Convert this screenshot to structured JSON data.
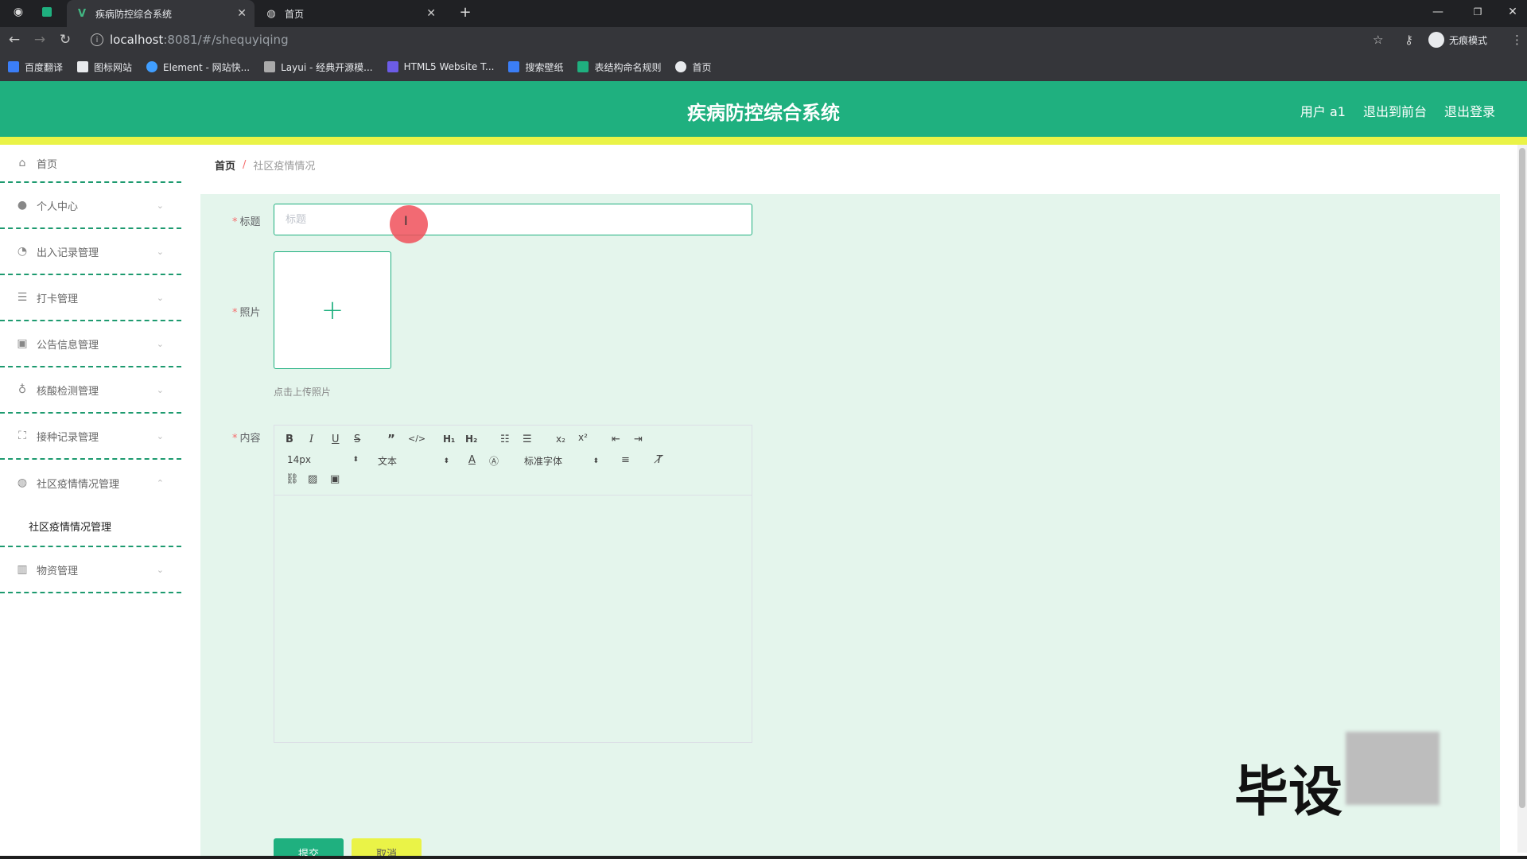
{
  "browser": {
    "tabs": [
      {
        "title": "疾病防控综合系统",
        "active": true,
        "icon": "vue-icon"
      },
      {
        "title": "首页",
        "active": false,
        "icon": "globe-icon"
      }
    ],
    "url_host": "localhost",
    "url_path": ":8081/#/shequyiqing",
    "incognito_label": "无痕模式",
    "bookmarks": [
      {
        "label": "百度翻译",
        "icon": "translate-icon",
        "color": "#3b7ef6"
      },
      {
        "label": "图标网站",
        "icon": "flag-icon",
        "color": "#e8eaed"
      },
      {
        "label": "Element - 网站快...",
        "icon": "element-icon",
        "color": "#409eff"
      },
      {
        "label": "Layui - 经典开源模...",
        "icon": "layui-icon",
        "color": "#aaaaaa"
      },
      {
        "label": "HTML5 Website T...",
        "icon": "html5-icon",
        "color": "#6c5ce7"
      },
      {
        "label": "搜索壁纸",
        "icon": "wallpaper-icon",
        "color": "#3b7ef6"
      },
      {
        "label": "表结构命名规则",
        "icon": "table-icon",
        "color": "#1fb07f"
      },
      {
        "label": "首页",
        "icon": "globe-icon",
        "color": "#e8eaed"
      }
    ]
  },
  "header": {
    "title": "疾病防控综合系统",
    "user": "用户 a1",
    "frontend_link": "退出到前台",
    "logout": "退出登录",
    "brand_color": "#1fb07f",
    "accent_color": "#eaf347"
  },
  "sidebar": {
    "items": [
      {
        "label": "首页",
        "icon": "home-icon"
      },
      {
        "label": "个人中心",
        "icon": "user-icon"
      },
      {
        "label": "出入记录管理",
        "icon": "compass-icon"
      },
      {
        "label": "打卡管理",
        "icon": "list-icon"
      },
      {
        "label": "公告信息管理",
        "icon": "clipboard-icon"
      },
      {
        "label": "核酸检测管理",
        "icon": "microphone-icon"
      },
      {
        "label": "接种记录管理",
        "icon": "fullscreen-icon"
      },
      {
        "label": "社区疫情情况管理",
        "icon": "globe-icon"
      },
      {
        "label": "物资管理",
        "icon": "chart-icon"
      }
    ],
    "submenu_label": "社区疫情情况管理"
  },
  "breadcrumb": {
    "home": "首页",
    "separator": "/",
    "current": "社区疫情情况"
  },
  "form": {
    "title_label": "标题",
    "title_placeholder": "标题",
    "title_value": "",
    "photo_label": "照片",
    "photo_hint": "点击上传照片",
    "content_label": "内容",
    "required_mark": "*",
    "submit_label": "提交",
    "cancel_label": "取消"
  },
  "editor": {
    "font_size": "14px",
    "block_format": "文本",
    "font_family": "标准字体"
  },
  "watermark": "毕设"
}
